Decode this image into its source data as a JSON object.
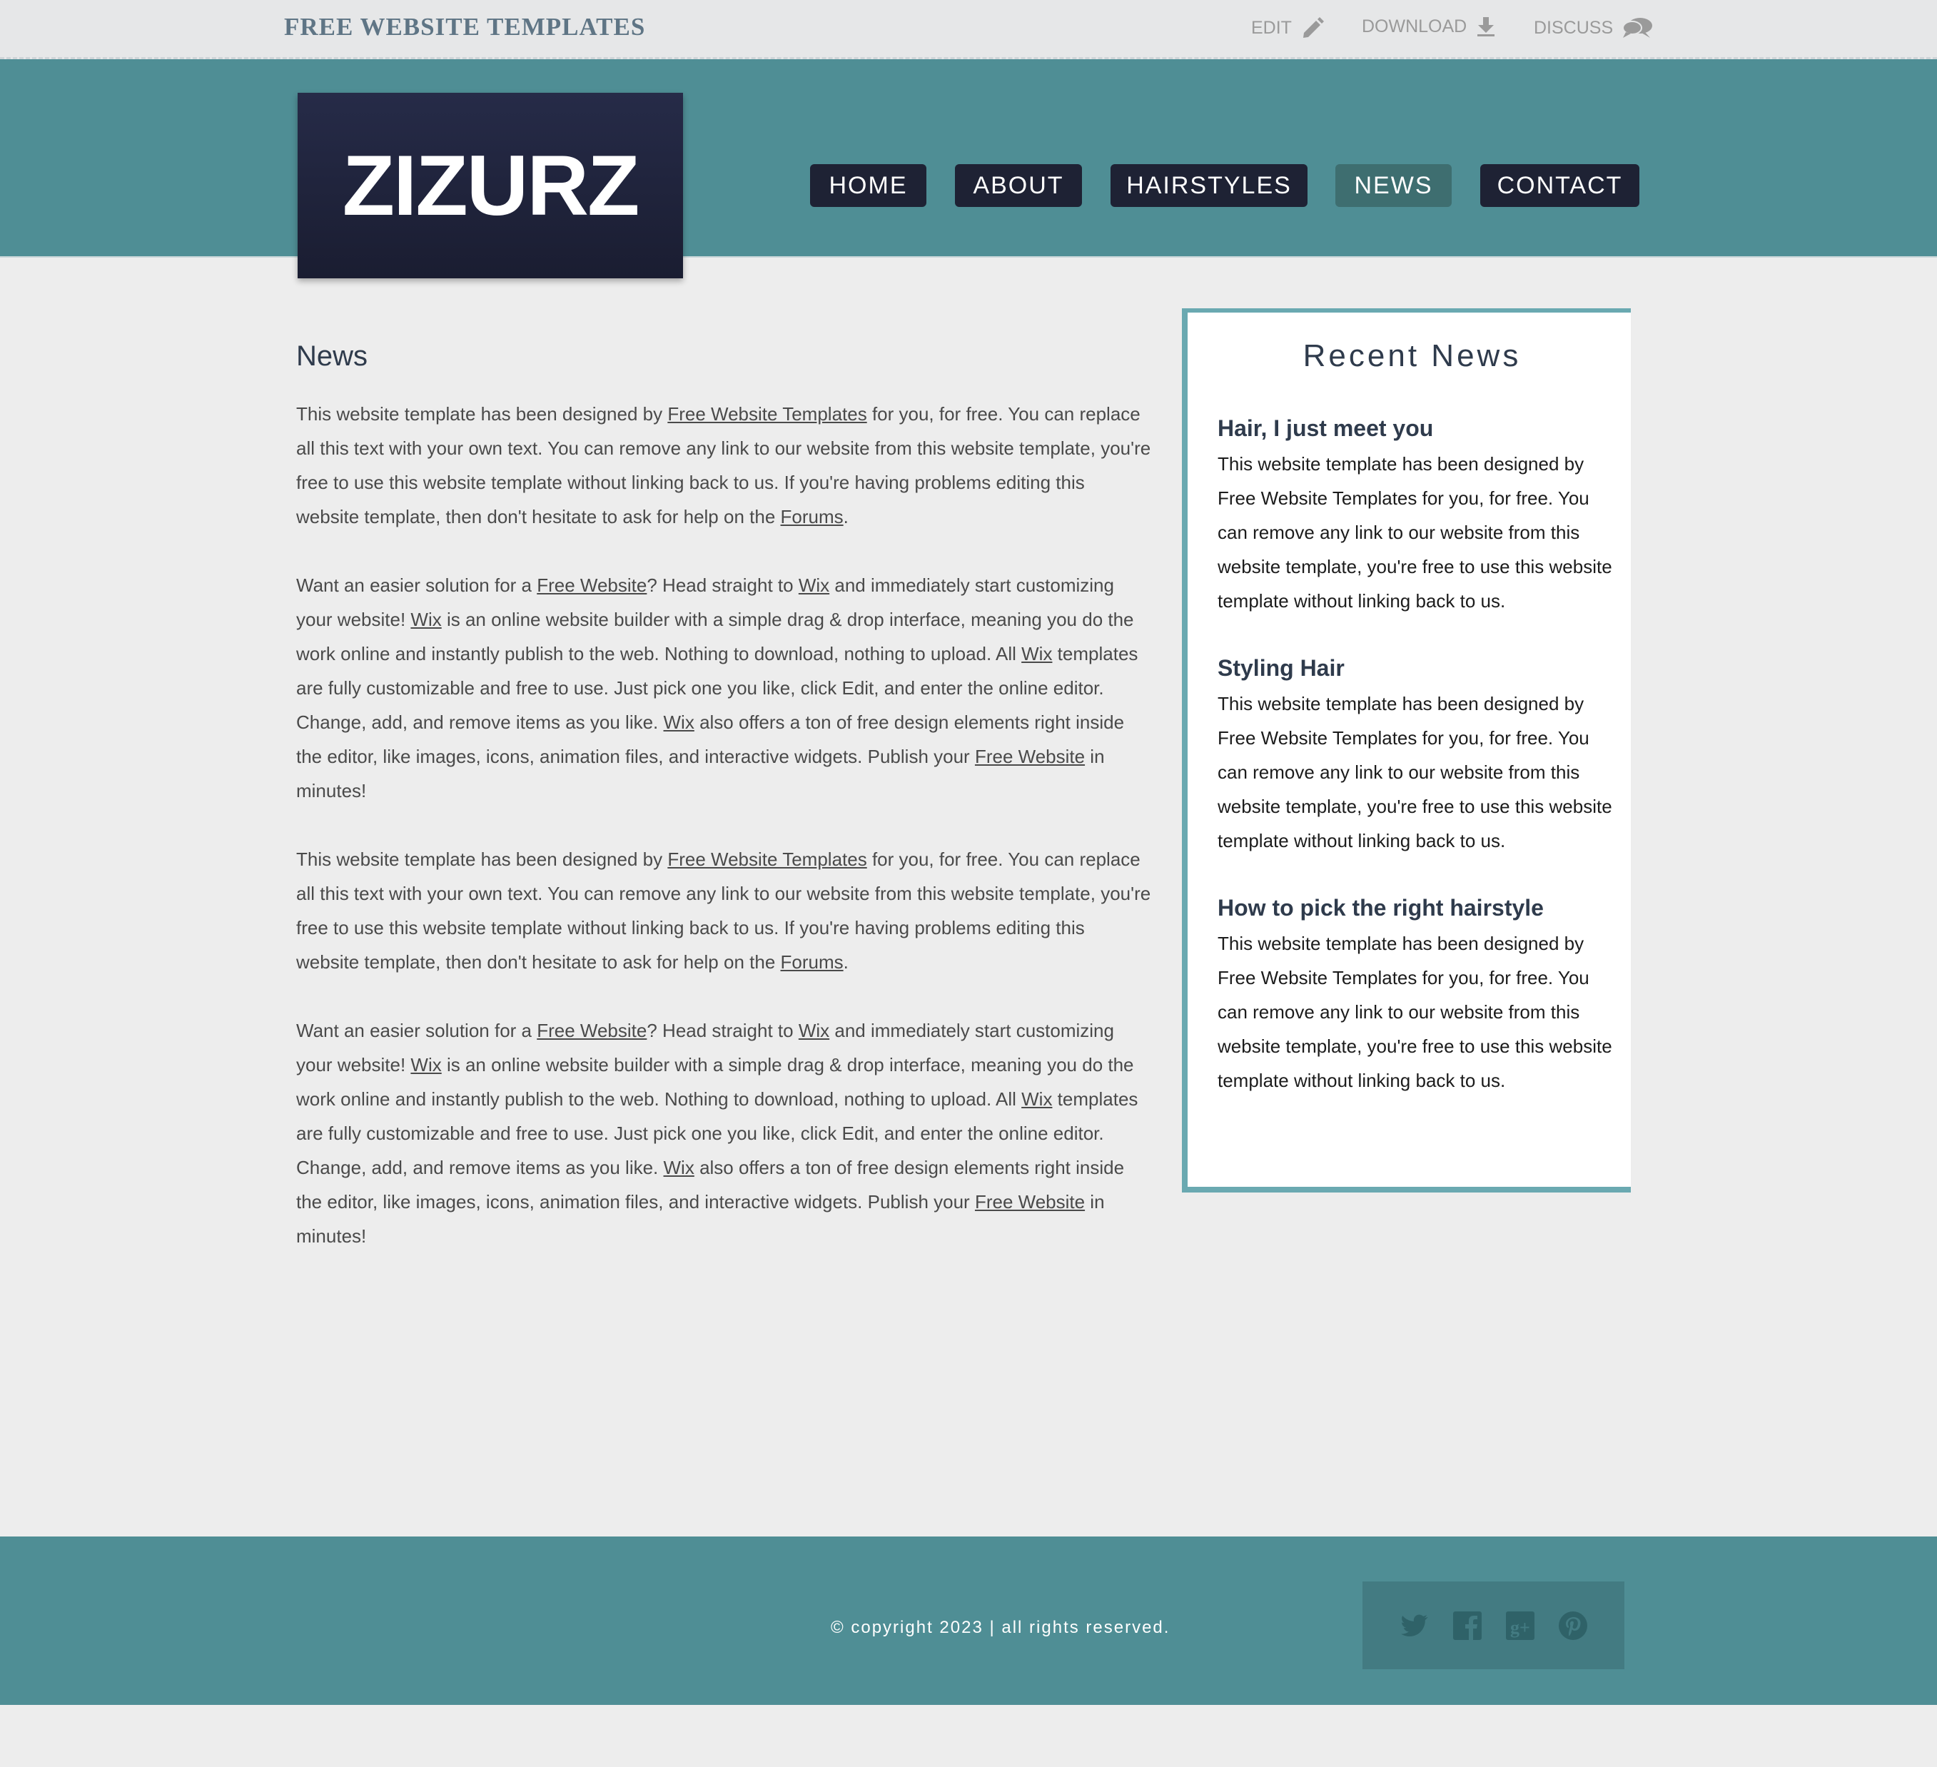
{
  "topbar": {
    "brand": "FREE WEBSITE TEMPLATES",
    "links": [
      {
        "label": "EDIT",
        "icon": "pencil-icon"
      },
      {
        "label": "DOWNLOAD",
        "icon": "download-icon"
      },
      {
        "label": "DISCUSS",
        "icon": "chat-bubbles-icon"
      }
    ]
  },
  "header": {
    "logo": "ZIZURZ",
    "nav": [
      {
        "label": "HOME",
        "active": false
      },
      {
        "label": "ABOUT",
        "active": false
      },
      {
        "label": "HAIRSTYLES",
        "active": false
      },
      {
        "label": "NEWS",
        "active": true
      },
      {
        "label": "CONTACT",
        "active": false
      }
    ]
  },
  "main": {
    "title": "News",
    "p1": {
      "t1": "This website template has been designed by ",
      "link1": "Free Website Templates",
      "t2": " for you, for free. You can replace all this text with your own text. You can remove any link to our website from this website template, you're free to use this website template without linking back to us. If you're having problems editing this website template, then don't hesitate to ask for help on the ",
      "link2": "Forums",
      "t3": "."
    },
    "p2": {
      "t1": "Want an easier solution for a ",
      "link1": "Free Website",
      "t2": "? Head straight to ",
      "link2": "Wix",
      "t3": " and immediately start customizing your website! ",
      "link3": "Wix",
      "t4": " is an online website builder with a simple drag & drop interface, meaning you do the work online and instantly publish to the web. Nothing to download, nothing to upload. All ",
      "link4": "Wix",
      "t5": " templates are fully customizable and free to use. Just pick one you like, click Edit, and enter the online editor. Change, add, and remove items as you like. ",
      "link5": "Wix",
      "t6": " also offers a ton of free design elements right inside the editor, like images, icons, animation files, and interactive widgets. Publish your ",
      "link6": "Free Website",
      "t7": " in minutes!"
    }
  },
  "sidebar": {
    "title": "Recent News",
    "items": [
      {
        "title": "Hair, I just meet you",
        "text": "This website template has been designed by Free Website Templates for you, for free. You can remove any link to our website from this website template, you're free to use this website template without linking back to us."
      },
      {
        "title": "Styling Hair",
        "text": "This website template has been designed by Free Website Templates for you, for free. You can remove any link to our website from this website template, you're free to use this website template without linking back to us."
      },
      {
        "title": "How to pick the right hairstyle",
        "text": "This website template has been designed by Free Website Templates for you, for free. You can remove any link to our website from this website template, you're free to use this website template without linking back to us."
      }
    ]
  },
  "footer": {
    "copyright": "© copyright 2023 | all rights reserved.",
    "social": [
      "twitter-icon",
      "facebook-icon",
      "google-plus-icon",
      "pinterest-icon"
    ]
  },
  "colors": {
    "teal": "#4f8e95",
    "teal_dark": "#437b82",
    "navy": "#1e2234",
    "nav_active": "#3e6e70",
    "sidebar_border": "#6aa9b1",
    "page_bg": "#ededed"
  }
}
